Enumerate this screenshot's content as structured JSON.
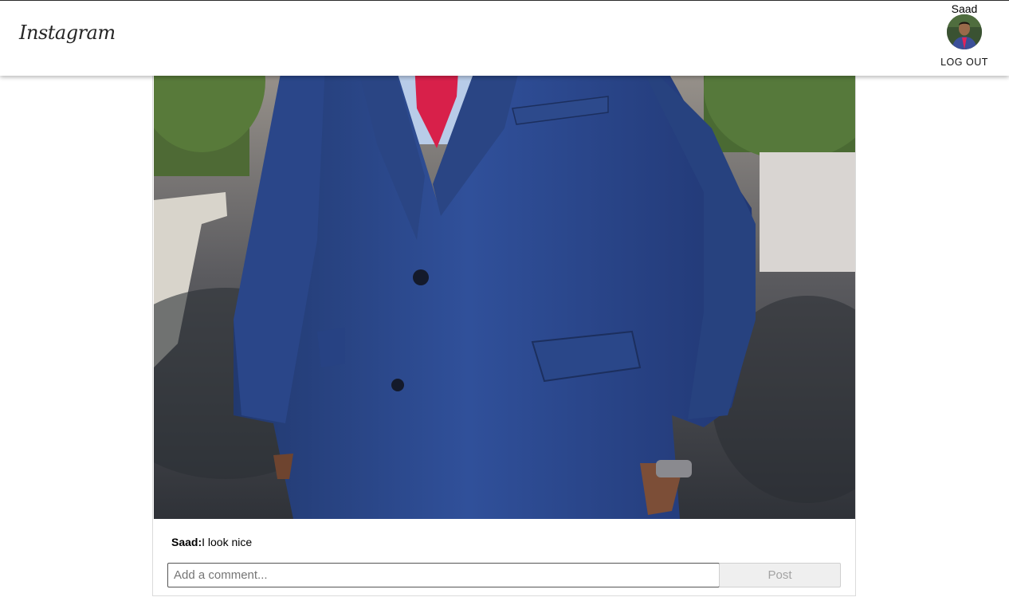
{
  "header": {
    "logo": "Instagram",
    "user": {
      "name": "Saad",
      "logout_label": "LOG OUT"
    }
  },
  "post": {
    "image_alt": "Person wearing a blue three-piece suit with a pink tie",
    "caption": {
      "username": "Saad:",
      "text": "I look nice"
    },
    "comment_box": {
      "placeholder": "Add a comment...",
      "value": ""
    },
    "post_button_label": "Post"
  },
  "colors": {
    "suit": "#2c4a8c",
    "tie": "#d8204a",
    "post_button_bg": "#efefef",
    "post_button_text": "#a3a3a3"
  }
}
